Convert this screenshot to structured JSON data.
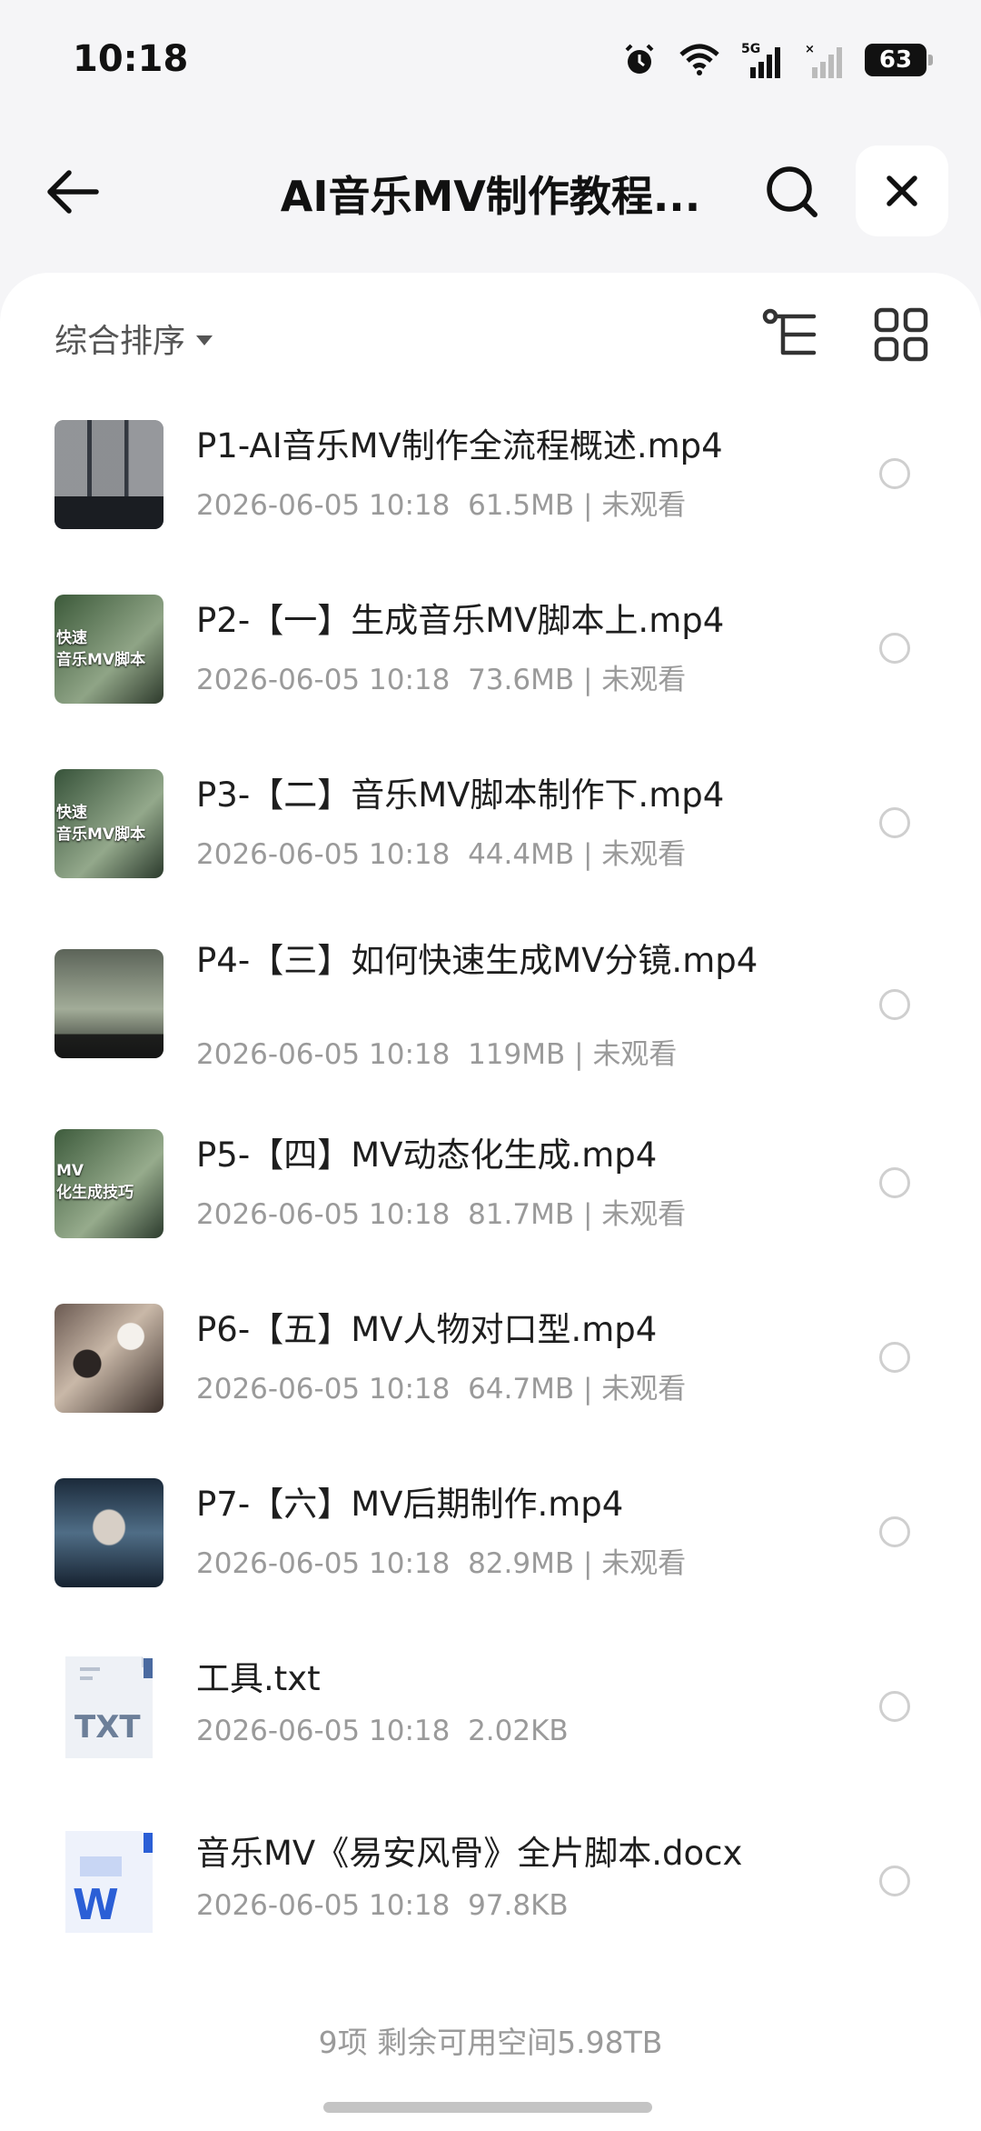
{
  "status": {
    "time": "10:18",
    "battery": "63",
    "network": "5G"
  },
  "nav": {
    "title": "AI音乐MV制作教程..."
  },
  "toolbar": {
    "sort_label": "综合排序"
  },
  "files": [
    {
      "name": "P1-AI音乐MV制作全流程概述.mp4",
      "date": "2026-06-05 10:18",
      "size": "61.5MB",
      "status": "未观看",
      "thumb_text": ""
    },
    {
      "name": "P2-【一】生成音乐MV脚本上.mp4",
      "date": "2026-06-05 10:18",
      "size": "73.6MB",
      "status": "未观看",
      "thumb_text": "快速\n音乐MV脚本"
    },
    {
      "name": "P3-【二】音乐MV脚本制作下.mp4",
      "date": "2026-06-05 10:18",
      "size": "44.4MB",
      "status": "未观看",
      "thumb_text": "快速\n音乐MV脚本"
    },
    {
      "name": "P4-【三】如何快速生成MV分镜.mp4",
      "date": "2026-06-05 10:18",
      "size": "119MB",
      "status": "未观看",
      "thumb_text": ""
    },
    {
      "name": "P5-【四】MV动态化生成.mp4",
      "date": "2026-06-05 10:18",
      "size": "81.7MB",
      "status": "未观看",
      "thumb_text": "MV\n化生成技巧"
    },
    {
      "name": "P6-【五】MV人物对口型.mp4",
      "date": "2026-06-05 10:18",
      "size": "64.7MB",
      "status": "未观看",
      "thumb_text": ""
    },
    {
      "name": "P7-【六】MV后期制作.mp4",
      "date": "2026-06-05 10:18",
      "size": "82.9MB",
      "status": "未观看",
      "thumb_text": ""
    },
    {
      "name": "工具.txt",
      "date": "2026-06-05 10:18",
      "size": "2.02KB",
      "status": "",
      "thumb_text": "TXT"
    },
    {
      "name": "音乐MV《易安风骨》全片脚本.docx",
      "date": "2026-06-05 10:18",
      "size": "97.8KB",
      "status": "",
      "thumb_text": "W"
    }
  ],
  "footer": {
    "summary": "9项 剩余可用空间5.98TB"
  }
}
